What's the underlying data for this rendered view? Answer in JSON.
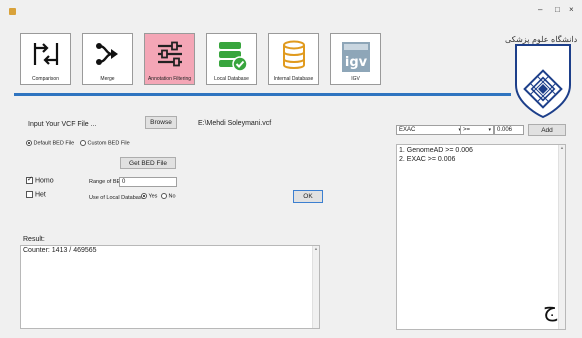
{
  "window": {
    "minimize": "–",
    "maximize": "□",
    "close": "×"
  },
  "toolbar": {
    "tiles": [
      {
        "label": "Comparison",
        "color": "#ffffff"
      },
      {
        "label": "Merge",
        "color": "#ffffff"
      },
      {
        "label": "Annotation Filtering",
        "color": "#f4a6b6"
      },
      {
        "label": "Local Database",
        "color": "#ffffff"
      },
      {
        "label": "Internal Database",
        "color": "#ffffff"
      },
      {
        "label": "IGV",
        "color": "#ffffff"
      }
    ]
  },
  "logo": {
    "text": "دانشگاه علوم پزشکی"
  },
  "input": {
    "label": "Input Your VCF File ...",
    "browse": "Browse",
    "file_path": "E:\\Mehdi Soleymani.vcf"
  },
  "bed": {
    "default_label": "Default BED File",
    "custom_label": "Custom BED File",
    "get_button": "Get BED File",
    "range_label": "Range of BED:",
    "range_value": "0"
  },
  "zygosity": {
    "homo": "Homo",
    "het": "Het"
  },
  "local_db": {
    "label": "Use of Local Database",
    "yes": "Yes",
    "no": "No"
  },
  "ok_button": "OK",
  "result": {
    "label": "Result:",
    "text": "Counter: 1413 / 469565"
  },
  "filter": {
    "field": "EXAC",
    "operator": ">=",
    "value": "0.006",
    "add_button": "Add",
    "items": [
      "1. GenomeAD >= 0.006",
      "2. EXAC >= 0.006"
    ]
  },
  "footer_glyph": "ج",
  "colors": {
    "accent_line": "#2f74c0",
    "green_tile": "#38a53d",
    "pink_tile": "#f4a6b6"
  }
}
